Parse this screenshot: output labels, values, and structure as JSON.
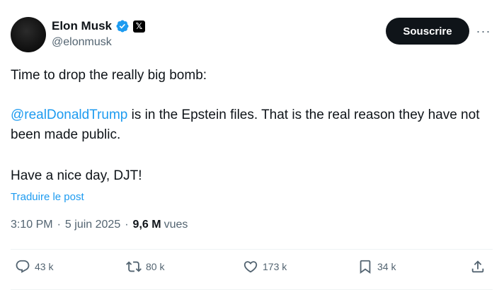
{
  "author": {
    "display_name": "Elon Musk",
    "handle": "@elonmusk",
    "badge_x_glyph": "𝕏"
  },
  "header": {
    "subscribe_label": "Souscrire",
    "more_glyph": "···"
  },
  "tweet": {
    "line1": "Time to drop the really big bomb:",
    "mention": "@realDonaldTrump",
    "para2_rest": " is in the Epstein files. That is the real reason they have not been made public.",
    "para3": "Have a nice day, DJT!",
    "translate_label": "Traduire le post"
  },
  "meta": {
    "time": "3:10 PM",
    "dot1": "·",
    "date": "5 juin 2025",
    "dot2": "·",
    "views_count": "9,6 M",
    "views_label": "vues"
  },
  "actions": {
    "reply_count": "43 k",
    "retweet_count": "80 k",
    "like_count": "173 k",
    "bookmark_count": "34 k"
  },
  "colors": {
    "text_primary": "#0f1419",
    "text_secondary": "#536471",
    "link_blue": "#1d9bf0",
    "verified_blue": "#1d9bf0",
    "divider": "#eff3f4"
  },
  "icons": [
    "verified-badge-icon",
    "x-logo-icon",
    "more-icon",
    "reply-icon",
    "retweet-icon",
    "like-icon",
    "bookmark-icon",
    "share-icon"
  ]
}
